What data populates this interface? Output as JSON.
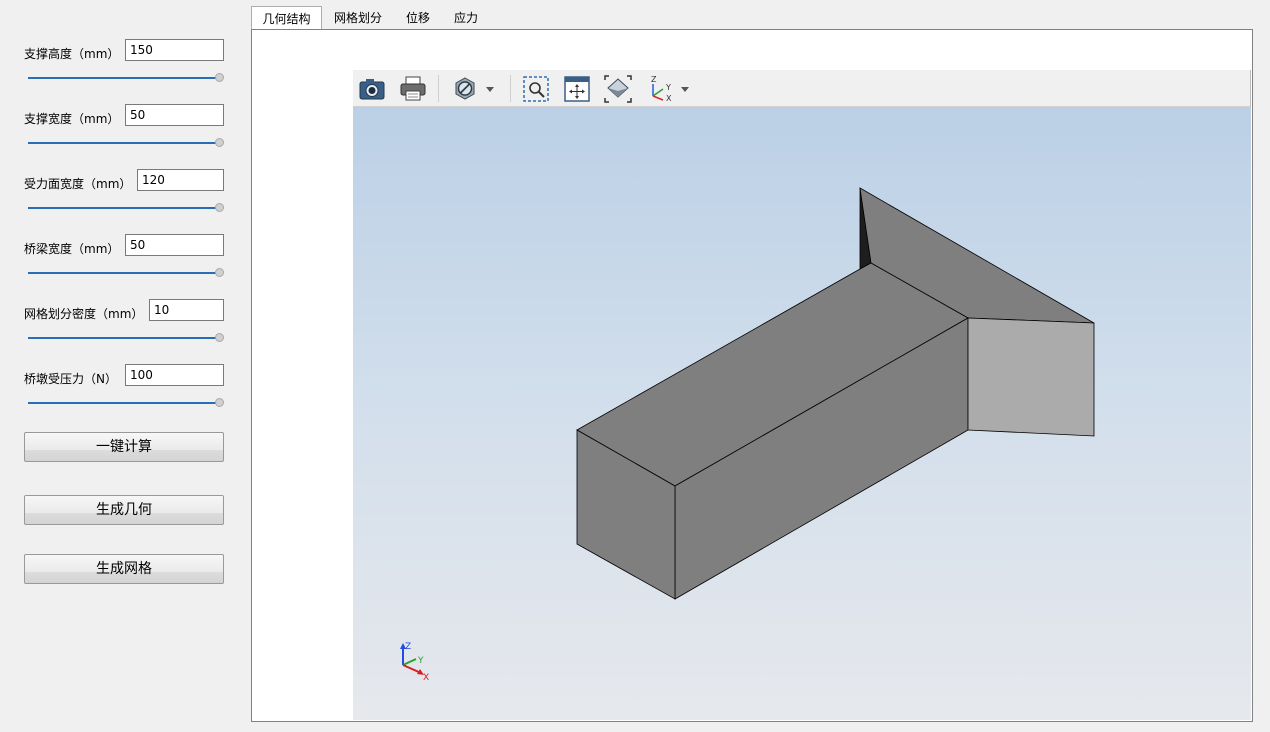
{
  "params": [
    {
      "label": "支撑高度（mm）",
      "value": "150"
    },
    {
      "label": "支撑宽度（mm）",
      "value": "50"
    },
    {
      "label": "受力面宽度（mm）",
      "value": "120"
    },
    {
      "label": "桥梁宽度（mm）",
      "value": "50"
    },
    {
      "label": "网格划分密度（mm）",
      "value": "10"
    },
    {
      "label": "桥墩受压力（N）",
      "value": "100"
    }
  ],
  "buttons": {
    "compute": "一键计算",
    "geometry": "生成几何",
    "mesh": "生成网格"
  },
  "tabs": [
    {
      "label": "几何结构",
      "active": true
    },
    {
      "label": "网格划分",
      "active": false
    },
    {
      "label": "位移",
      "active": false
    },
    {
      "label": "应力",
      "active": false
    }
  ],
  "toolbar_icons": [
    "camera-icon",
    "print-icon",
    "display-mode-icon",
    "dropdown-arrow-icon",
    "zoom-window-icon",
    "fit-all-icon",
    "view-iso-icon",
    "axis-orientation-icon",
    "dropdown-arrow-icon"
  ],
  "axis_triad": {
    "z": "Z",
    "y": "Y",
    "x": "X"
  },
  "colors": {
    "slider_track": "#2a6db5",
    "model_top": "#7f7f7f",
    "model_side": "#ababab",
    "viewport_top": "#bbd0e6",
    "viewport_bottom": "#e6e8ec"
  }
}
